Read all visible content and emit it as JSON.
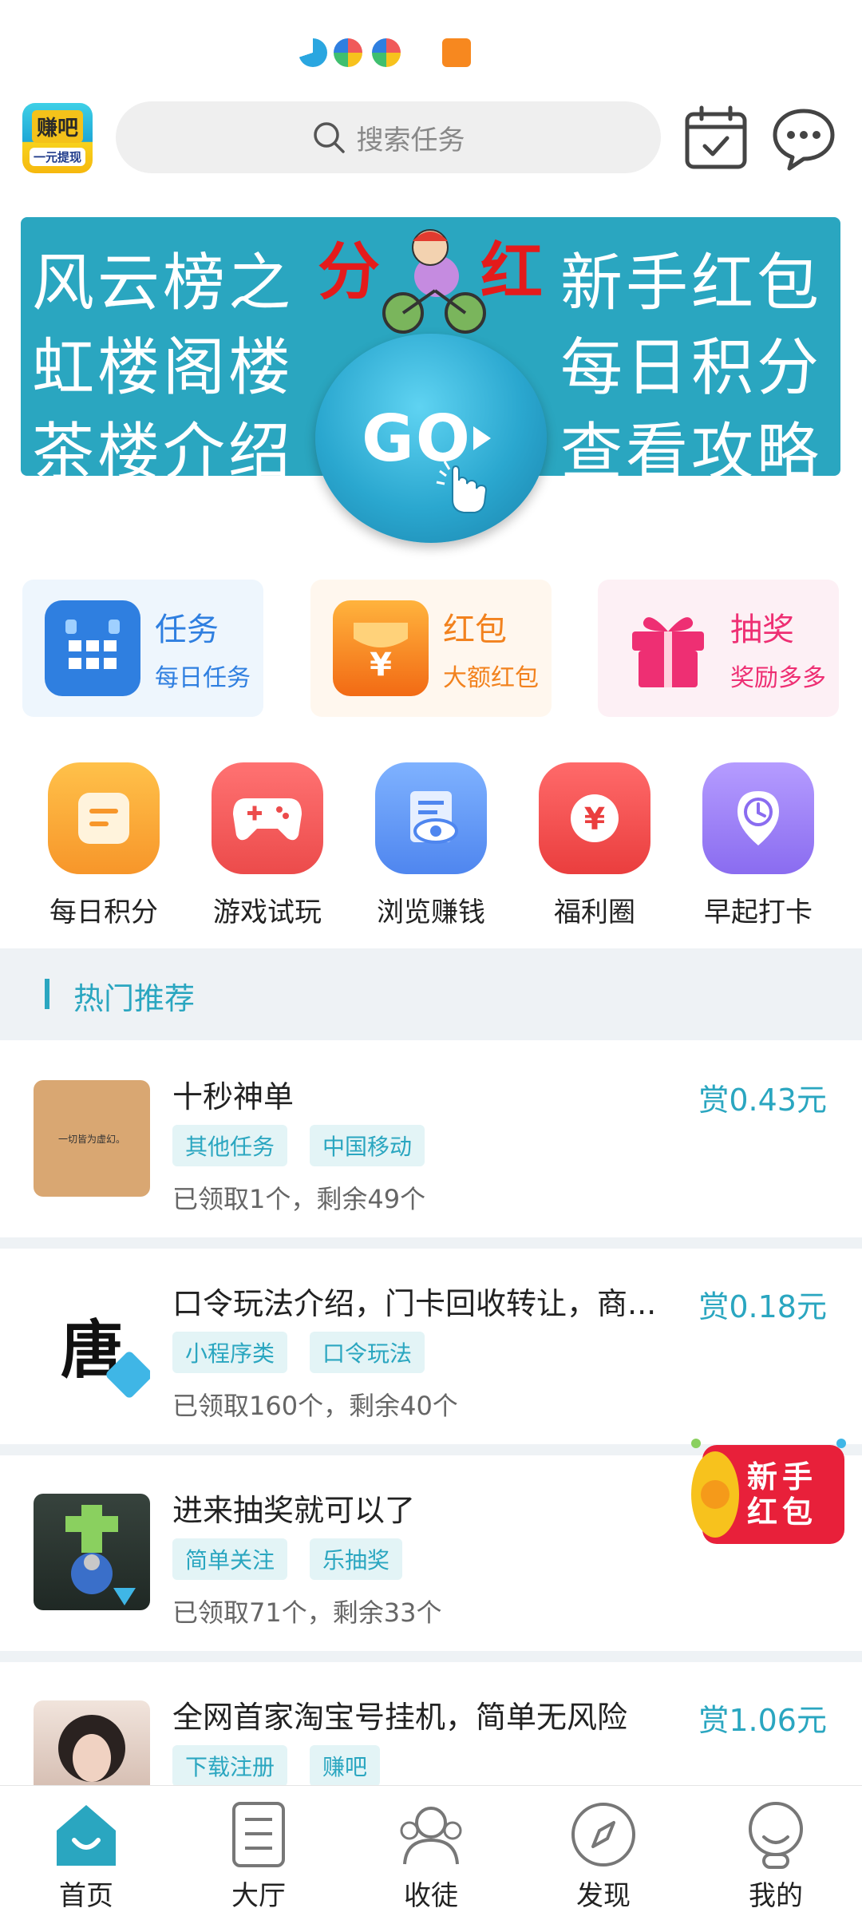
{
  "status_bar": {
    "icons": [
      "qq-browser-icon",
      "pinwheel-icon",
      "pinwheel-icon-2",
      "video-play-icon"
    ]
  },
  "header": {
    "logo": {
      "line1": "赚吧",
      "line2": "一元提现"
    },
    "search": {
      "placeholder": "搜索任务"
    },
    "icons": [
      "calendar-check-icon",
      "message-icon"
    ]
  },
  "banner": {
    "left_row1": "风云榜之",
    "left_row2": "虹楼阁楼",
    "left_row3": "茶楼介绍",
    "red_left": "分",
    "red_right": "红",
    "right_row1": "新手红包",
    "right_row2": "每日积分",
    "right_row3": "查看攻略",
    "go_label": "GO",
    "colors": {
      "bg": "#2aa6c0",
      "accent": "#e41b1b"
    }
  },
  "cards": [
    {
      "title": "任务",
      "subtitle": "每日任务",
      "color": "#2f7fe0",
      "bg": "#eef6fd",
      "icon": "calendar-icon"
    },
    {
      "title": "红包",
      "subtitle": "大额红包",
      "color": "#f2821e",
      "bg": "#fff7ee",
      "icon": "red-envelope-icon"
    },
    {
      "title": "抽奖",
      "subtitle": "奖励多多",
      "color": "#ee2f73",
      "bg": "#fdf0f5",
      "icon": "gift-icon"
    }
  ],
  "grid": [
    {
      "label": "每日积分",
      "icon": "note-icon",
      "color": "#f7a22f"
    },
    {
      "label": "游戏试玩",
      "icon": "gamepad-icon",
      "color": "#f05a5a"
    },
    {
      "label": "浏览赚钱",
      "icon": "eye-document-icon",
      "color": "#5b95f0"
    },
    {
      "label": "福利圈",
      "icon": "yen-coin-icon",
      "color": "#f04b4b"
    },
    {
      "label": "早起打卡",
      "icon": "clock-pin-icon",
      "color": "#9b7cf0"
    }
  ],
  "section": {
    "title": "热门推荐"
  },
  "tasks": [
    {
      "name": "十秒神单",
      "reward": "赏0.43元",
      "tags": [
        "其他任务",
        "中国移动"
      ],
      "stats": "已领取1个，剩余49个",
      "thumb_text": "一切皆为虚幻。"
    },
    {
      "name": "口令玩法介绍，门卡回收转让，商...",
      "reward": "赏0.18元",
      "tags": [
        "小程序类",
        "口令玩法"
      ],
      "stats": "已领取160个，剩余40个",
      "thumb_text": "唐"
    },
    {
      "name": "进来抽奖就可以了",
      "reward": "",
      "tags": [
        "简单关注",
        "乐抽奖"
      ],
      "stats": "已领取71个，剩余33个",
      "thumb_text": ""
    },
    {
      "name": "全网首家淘宝号挂机，简单无风险",
      "reward": "赏1.06元",
      "tags": [
        "下载注册",
        "赚吧"
      ],
      "stats": "",
      "thumb_text": ""
    }
  ],
  "float_promo": {
    "line1": "新手",
    "line2": "红包"
  },
  "bottom_nav": [
    {
      "label": "首页",
      "icon": "home-icon",
      "active": true
    },
    {
      "label": "大厅",
      "icon": "list-icon",
      "active": false
    },
    {
      "label": "收徒",
      "icon": "users-icon",
      "active": false
    },
    {
      "label": "发现",
      "icon": "compass-icon",
      "active": false
    },
    {
      "label": "我的",
      "icon": "profile-icon",
      "active": false
    }
  ]
}
